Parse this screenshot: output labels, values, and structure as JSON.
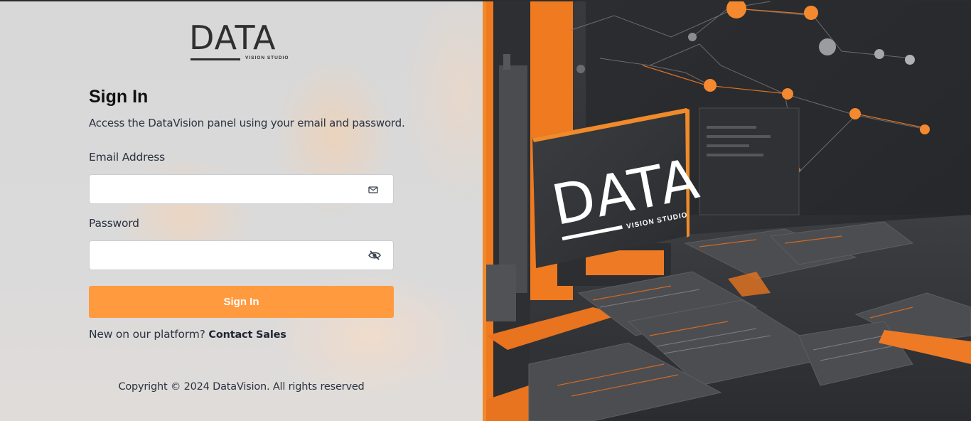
{
  "logo": {
    "main": "DATA",
    "sub": "VISION STUDIO"
  },
  "signin": {
    "title": "Sign In",
    "subtitle": "Access the DataVision panel using your email and password.",
    "email_label": "Email Address",
    "email_value": "",
    "password_label": "Password",
    "password_value": "",
    "button_label": "Sign In",
    "new_prompt": "New on our platform?",
    "contact_link": "Contact Sales"
  },
  "footer": {
    "copyright": "Copyright © 2024 DataVision. All rights reserved"
  },
  "hero": {
    "sign_main": "DATA",
    "sign_sub": "VISION STUDIO"
  },
  "icons": {
    "email": "mail-icon",
    "password": "eye-off-icon"
  },
  "colors": {
    "accent": "#ff9a3f",
    "divider": "#f08a2a",
    "text": "#2b3340"
  }
}
